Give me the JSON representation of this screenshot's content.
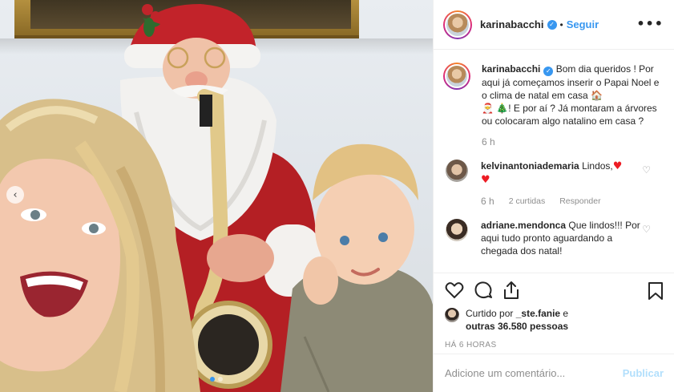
{
  "photo": {
    "alt": "",
    "nav_prev": "‹",
    "dots": [
      true,
      false
    ]
  },
  "post": {
    "username": "karinabacchi",
    "separator": "•",
    "follow_label": "Seguir",
    "more_label": "•••",
    "caption": "Bom dia queridos ! Por aqui já começamos inserir o Papai Noel e o clima de natal em casa",
    "caption_emoji_1": "🏠",
    "caption_emoji_2": "🎅",
    "caption_emoji_3": "🎄",
    "caption_tail": "! E por aí ? Já montaram a árvores ou colocaram algo natalino em casa ?",
    "caption_time": "6 h"
  },
  "comments": [
    {
      "username": "kelvinantoniademaria",
      "text": "Lindos,",
      "hearts": "♥",
      "heart2": "♥",
      "time": "6 h",
      "likes": "2 curtidas",
      "reply": "Responder"
    },
    {
      "username": "adriane.mendonca",
      "text": "Que lindos!!! Por aqui tudo pronto aguardando a chegada dos natal!"
    }
  ],
  "actions": {
    "liked_by_prefix": "Curtido por",
    "liked_by_user": "_ste.fanie",
    "liked_by_and": "e",
    "liked_by_others": "outras 36.580 pessoas",
    "timestamp": "HÁ 6 HORAS"
  },
  "add_comment": {
    "placeholder": "Adicione um comentário...",
    "publish_label": "Publicar"
  },
  "colors": {
    "link_blue": "#3897f0",
    "publish_disabled": "#b2dffc",
    "heart_red": "#ed1c24"
  },
  "icons": [
    "heart-icon",
    "comment-icon",
    "share-icon",
    "bookmark-icon",
    "verified-icon",
    "more-icon"
  ]
}
